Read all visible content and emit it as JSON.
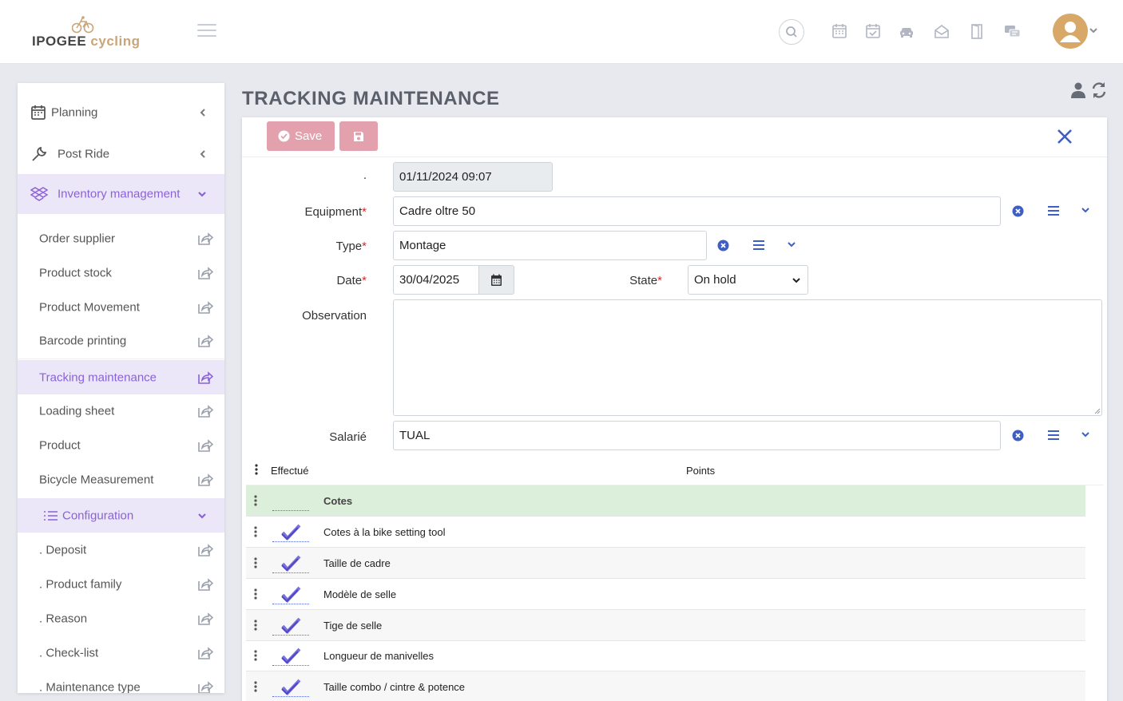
{
  "brand": {
    "name_part1": "IPOGEE",
    "name_part2": "cycling"
  },
  "colors": {
    "accent": "#8a62d6",
    "accent_bg": "#ece7f8",
    "save_btn": "#e3a1ad",
    "close": "#3f5ec4",
    "check": "#6f66d6",
    "group_row": "#dcefdb",
    "required": "#d12b2b"
  },
  "topbar": {
    "icons": [
      "calendar-grid-icon",
      "calendar-check-icon",
      "car-icon",
      "envelope-open-icon",
      "door-icon",
      "chat-icon"
    ]
  },
  "sidebar": {
    "items": [
      {
        "label": "Planning"
      },
      {
        "label": "Post Ride"
      },
      {
        "label": "Inventory management"
      }
    ],
    "sub_items": [
      {
        "label": "Order supplier"
      },
      {
        "label": "Product stock"
      },
      {
        "label": "Product Movement"
      },
      {
        "label": "Barcode printing"
      },
      {
        "label": "Tracking maintenance"
      },
      {
        "label": "Loading sheet"
      },
      {
        "label": "Product"
      },
      {
        "label": "Bicycle Measurement"
      }
    ],
    "configuration": {
      "label": "Configuration"
    },
    "config_items": [
      {
        "label": ". Deposit"
      },
      {
        "label": ". Product family"
      },
      {
        "label": ". Reason"
      },
      {
        "label": ". Check-list"
      },
      {
        "label": ". Maintenance type"
      }
    ]
  },
  "page": {
    "title": "TRACKING MAINTENANCE"
  },
  "toolbar": {
    "save_label": "Save"
  },
  "form": {
    "created_label": ".",
    "created_value": "01/11/2024 09:07",
    "equipment_label": "Equipment",
    "equipment_value": "Cadre oltre 50",
    "type_label": "Type",
    "type_value": "Montage",
    "date_label": "Date",
    "date_value": "30/04/2025",
    "state_label": "State",
    "state_value": "On hold",
    "observation_label": "Observation",
    "salarie_label": "Salarié",
    "salarie_value": "TUAL",
    "required_mark": "*"
  },
  "grid": {
    "col_effectue": "Effectué",
    "col_points": "Points",
    "rows": [
      {
        "point": "Cotes",
        "group": true
      },
      {
        "point": "Cotes à la bike setting tool",
        "done": true
      },
      {
        "point": "Taille de cadre",
        "done": true
      },
      {
        "point": "Modèle de selle",
        "done": true
      },
      {
        "point": "Tige de selle",
        "done": true
      },
      {
        "point": "Longueur de manivelles",
        "done": true
      },
      {
        "point": "Taille combo / cintre & potence",
        "done": true
      }
    ]
  }
}
